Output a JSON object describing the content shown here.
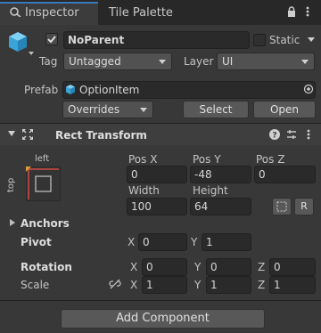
{
  "tabs": {
    "inspector": "Inspector",
    "tile_palette": "Tile Palette"
  },
  "gameobject": {
    "active": true,
    "name": "NoParent",
    "static_label": "Static",
    "static_checked": false,
    "tag_label": "Tag",
    "tag_value": "Untagged",
    "layer_label": "Layer",
    "layer_value": "UI",
    "prefab_label": "Prefab",
    "prefab_value": "OptionItem",
    "overrides_label": "Overrides",
    "select_label": "Select",
    "open_label": "Open"
  },
  "rect_transform": {
    "title": "Rect Transform",
    "anchor_left": "left",
    "anchor_top": "top",
    "pos_x_label": "Pos X",
    "pos_y_label": "Pos Y",
    "pos_z_label": "Pos Z",
    "pos_x": "0",
    "pos_y": "-48",
    "pos_z": "0",
    "width_label": "Width",
    "height_label": "Height",
    "width": "100",
    "height": "64",
    "raw_button_label": "R",
    "anchors_label": "Anchors",
    "pivot_label": "Pivot",
    "pivot_x_label": "X",
    "pivot_x": "0",
    "pivot_y_label": "Y",
    "pivot_y": "1",
    "rotation_label": "Rotation",
    "rot_x_label": "X",
    "rot_x": "0",
    "rot_y_label": "Y",
    "rot_y": "0",
    "rot_z_label": "Z",
    "rot_z": "0",
    "scale_label": "Scale",
    "scale_x_label": "X",
    "scale_x": "1",
    "scale_y_label": "Y",
    "scale_y": "1",
    "scale_z_label": "Z",
    "scale_z": "1"
  },
  "add_component_label": "Add Component",
  "colors": {
    "accent": "#3a79bb",
    "panel": "#383838",
    "field": "#2a2a2a",
    "anchor_red": "#d24b43"
  }
}
